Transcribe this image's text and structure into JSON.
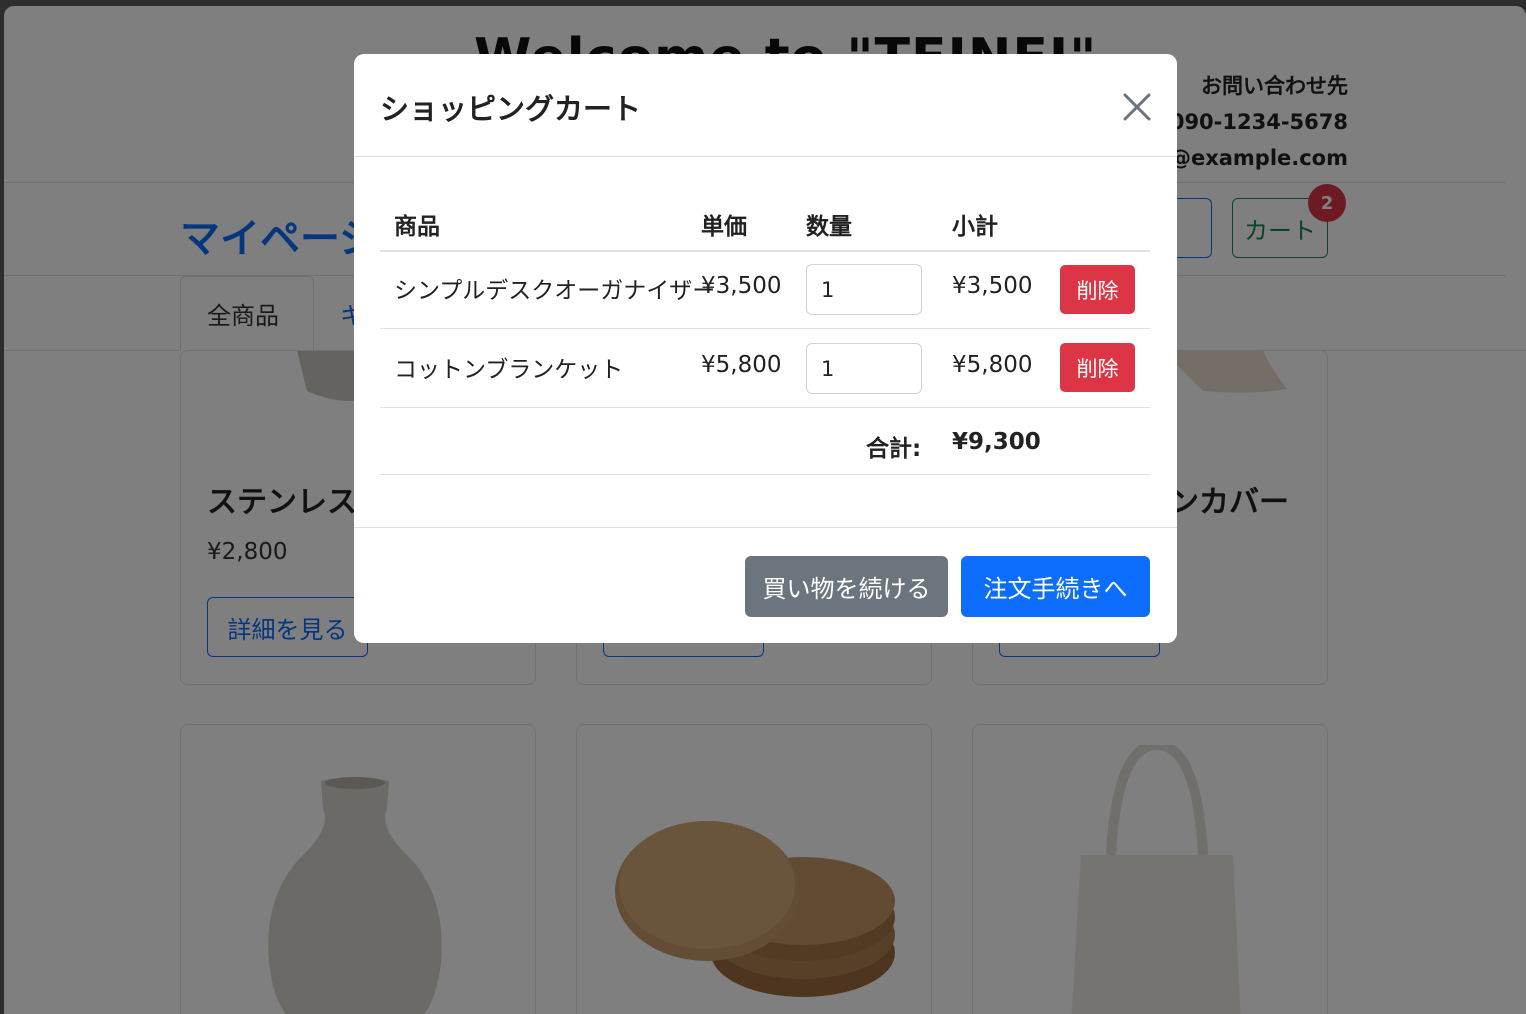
{
  "site": {
    "title": "Welcome to \"TEINEI\"",
    "contact": {
      "label": "お問い合わせ先",
      "phone": "090-1234-5678",
      "email": "e@example.com"
    }
  },
  "nav": {
    "mypage": "マイページ",
    "partial_button": "ト",
    "cart_button": "カート",
    "cart_count": "2"
  },
  "tabs": {
    "active": "全商品",
    "next_partial": "キ"
  },
  "products": [
    {
      "name": "ステンレスタ",
      "price": "¥2,800",
      "button": "詳細を見る"
    },
    {
      "name": "",
      "price": "",
      "button": ""
    },
    {
      "name": "ンカバー",
      "price": "",
      "button": ""
    }
  ],
  "modal": {
    "title": "ショッピングカート",
    "headers": {
      "product": "商品",
      "unit_price": "単価",
      "quantity": "数量",
      "subtotal": "小計"
    },
    "items": [
      {
        "name": "シンプルデスクオーガナイザー",
        "unit_price": "¥3,500",
        "quantity": "1",
        "subtotal": "¥3,500",
        "delete": "削除"
      },
      {
        "name": "コットンブランケット",
        "unit_price": "¥5,800",
        "quantity": "1",
        "subtotal": "¥5,800",
        "delete": "削除"
      }
    ],
    "total_label": "合計:",
    "total_value": "¥9,300",
    "continue_button": "買い物を続ける",
    "checkout_button": "注文手続きへ"
  },
  "colors": {
    "primary": "#0d6efd",
    "secondary": "#6c757d",
    "danger": "#dc3545",
    "success": "#198754"
  }
}
